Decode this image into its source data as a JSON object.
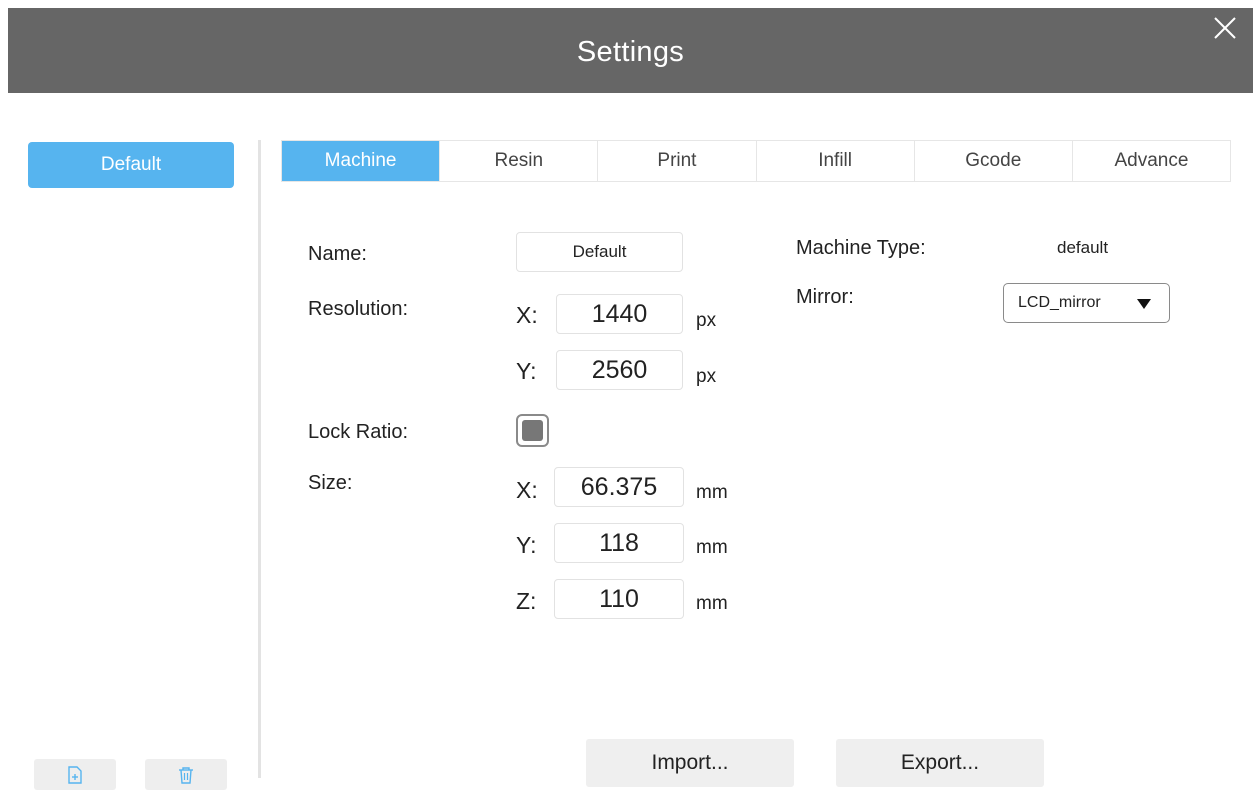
{
  "window": {
    "title": "Settings"
  },
  "sidebar": {
    "profiles": [
      "Default"
    ],
    "actions": {
      "add_icon": "file-add-icon",
      "delete_icon": "trash-icon"
    }
  },
  "tabs": [
    {
      "label": "Machine",
      "active": true
    },
    {
      "label": "Resin",
      "active": false
    },
    {
      "label": "Print",
      "active": false
    },
    {
      "label": "Infill",
      "active": false
    },
    {
      "label": "Gcode",
      "active": false
    },
    {
      "label": "Advance",
      "active": false
    }
  ],
  "machine": {
    "name_label": "Name:",
    "name_value": "Default",
    "resolution_label": "Resolution:",
    "resolution": {
      "x_label": "X:",
      "x_value": "1440",
      "x_unit": "px",
      "y_label": "Y:",
      "y_value": "2560",
      "y_unit": "px"
    },
    "lock_ratio_label": "Lock Ratio:",
    "lock_ratio_checked": true,
    "size_label": "Size:",
    "size": {
      "x_label": "X:",
      "x_value": "66.375",
      "x_unit": "mm",
      "y_label": "Y:",
      "y_value": "118",
      "y_unit": "mm",
      "z_label": "Z:",
      "z_value": "110",
      "z_unit": "mm"
    },
    "machine_type_label": "Machine Type:",
    "machine_type_value": "default",
    "mirror_label": "Mirror:",
    "mirror_value": "LCD_mirror"
  },
  "footer": {
    "import_label": "Import...",
    "export_label": "Export..."
  },
  "colors": {
    "accent": "#56b4ef",
    "titlebar": "#666666"
  }
}
